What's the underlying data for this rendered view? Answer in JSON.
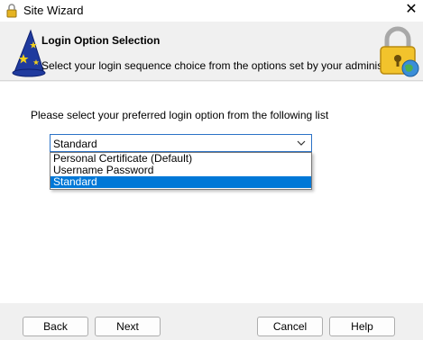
{
  "window": {
    "title": "Site Wizard",
    "close_glyph": "✕"
  },
  "header": {
    "title": "Login Option Selection",
    "subtitle": "Select your login sequence choice from the options set by your administrator"
  },
  "content": {
    "prompt": "Please select your preferred  login option from the following list",
    "select": {
      "value": "Standard",
      "options": [
        "Personal Certificate  (Default)",
        "Username Password",
        "Standard"
      ],
      "selected_index": 2
    }
  },
  "footer": {
    "back_label": "Back",
    "next_label": "Next",
    "cancel_label": "Cancel",
    "help_label": "Help"
  },
  "colors": {
    "selection": "#0078d7",
    "focus_border": "#2b72c6"
  }
}
